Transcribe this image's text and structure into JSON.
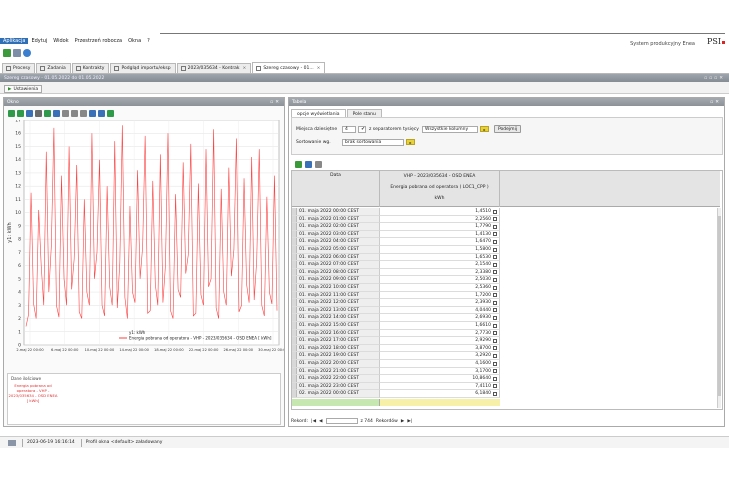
{
  "menu": [
    "Aplikacja",
    "Edytuj",
    "Widok",
    "Przestrzeń robocza",
    "Okna",
    "?"
  ],
  "app": {
    "name": "System produkcyjny Enea",
    "logo": "PSI"
  },
  "tabs": [
    {
      "label": "Procesy",
      "active": false
    },
    {
      "label": "Zadania",
      "active": false
    },
    {
      "label": "Kontrakty",
      "active": false
    },
    {
      "label": "Podgląd importu/eksp",
      "active": false
    },
    {
      "label": "2023/035634 - Kontrak",
      "active": false
    },
    {
      "label": "Szereg czasowy - 01...",
      "active": true
    }
  ],
  "window": {
    "title": "Szereg czasowy - 01.05.2022 do 01.05.2022",
    "settings_label": "Ustawienia"
  },
  "left_panel": {
    "title": "Okno",
    "legend_header": "Dane ilościowe",
    "legend_text": "Energia pobrana od operatora - VHP - 2023/035634 - OSD ENEA [ kWh]"
  },
  "right_panel": {
    "title": "Tabela",
    "subtabs": [
      "opcje wyświetlania",
      "Pole stanu"
    ],
    "decimals_label": "Miejsca dziesiętne",
    "decimals_value": "4",
    "separator_label": "z separatorem tysięcy",
    "columns_value": "Wszystkie kolumny",
    "apply_label": "Podejmij",
    "sort_label": "Sortowanie wg.",
    "sort_value": "brak sortowania",
    "col_date": "Data",
    "col_h1": "VHP - 2023/035634 - OSD ENEA",
    "col_h2": "Energia pobrana od operatora ( LOC1_CPP )",
    "col_h3": "kWh",
    "rows": [
      {
        "date": "01. maja 2022 00:00 CEST",
        "value": "1,4510"
      },
      {
        "date": "01. maja 2022 01:00 CEST",
        "value": "2,2560"
      },
      {
        "date": "01. maja 2022 02:00 CEST",
        "value": "1,7790"
      },
      {
        "date": "01. maja 2022 03:00 CEST",
        "value": "1,4130"
      },
      {
        "date": "01. maja 2022 04:00 CEST",
        "value": "1,6470"
      },
      {
        "date": "01. maja 2022 05:00 CEST",
        "value": "1,5800"
      },
      {
        "date": "01. maja 2022 06:00 CEST",
        "value": "1,6530"
      },
      {
        "date": "01. maja 2022 07:00 CEST",
        "value": "2,1540"
      },
      {
        "date": "01. maja 2022 08:00 CEST",
        "value": "2,3380"
      },
      {
        "date": "01. maja 2022 09:00 CEST",
        "value": "2,5030"
      },
      {
        "date": "01. maja 2022 10:00 CEST",
        "value": "2,5360"
      },
      {
        "date": "01. maja 2022 11:00 CEST",
        "value": "1,7200"
      },
      {
        "date": "01. maja 2022 12:00 CEST",
        "value": "2,3930"
      },
      {
        "date": "01. maja 2022 13:00 CEST",
        "value": "4,0440"
      },
      {
        "date": "01. maja 2022 14:00 CEST",
        "value": "2,6930"
      },
      {
        "date": "01. maja 2022 15:00 CEST",
        "value": "1,6610"
      },
      {
        "date": "01. maja 2022 16:00 CEST",
        "value": "2,7730"
      },
      {
        "date": "01. maja 2022 17:00 CEST",
        "value": "2,9290"
      },
      {
        "date": "01. maja 2022 18:00 CEST",
        "value": "3,8700"
      },
      {
        "date": "01. maja 2022 19:00 CEST",
        "value": "3,2920"
      },
      {
        "date": "01. maja 2022 20:00 CEST",
        "value": "4,1600"
      },
      {
        "date": "01. maja 2022 21:00 CEST",
        "value": "3,1700"
      },
      {
        "date": "01. maja 2022 22:00 CEST",
        "value": "10,8640"
      },
      {
        "date": "01. maja 2022 23:00 CEST",
        "value": "7,4110"
      },
      {
        "date": "02. maja 2022 00:00 CEST",
        "value": "6,1840"
      }
    ],
    "record_label": "Rekord:",
    "record_total": "z 744",
    "records_label": "Rekordów"
  },
  "status": {
    "timestamp": "2023-06-19 16:16:14",
    "message": "Profil okna <default> załadowany"
  },
  "colors": {
    "accent": "#2e6fb5",
    "series": "#ff4040",
    "highlight": "#e8d23a"
  },
  "chart_data": {
    "type": "line",
    "ylabel": "y1: kWh",
    "ylim": [
      0,
      17
    ],
    "yticks": [
      "0",
      "1",
      "2",
      "3",
      "4",
      "5",
      "6",
      "7",
      "8",
      "9",
      "10",
      "11",
      "12",
      "13",
      "14",
      "15",
      "16",
      "17"
    ],
    "xticks": [
      "2.maj 22 00:00",
      "6.maj 22 00:00",
      "10.maj 22 00:00",
      "14.maj 22 00:00",
      "18.maj 22 00:00",
      "22.maj 22 00:00",
      "26.maj 22 00:00",
      "30.maj 22 00:00"
    ],
    "legend_unit": "y1: kWh",
    "series": [
      {
        "name": "Energia pobrana od operatora - VHP - 2023/035634 - OSD ENEA [ kWh]",
        "values": [
          1.4,
          2.3,
          11.5,
          3.1,
          2.0,
          10.2,
          6.0,
          3.0,
          14.6,
          4.0,
          7.5,
          16.4,
          3.0,
          2.1,
          12.8,
          5.0,
          3.0,
          15.0,
          4.2,
          6.5,
          13.6,
          2.5,
          2.0,
          11.0,
          4.0,
          3.0,
          16.0,
          5.0,
          7.0,
          14.0,
          3.0,
          2.2,
          12.0,
          4.4,
          3.0,
          15.4,
          2.8,
          6.2,
          16.6,
          3.6,
          2.0,
          10.5,
          4.0,
          3.2,
          13.2,
          5.0,
          7.4,
          15.8,
          2.4,
          2.6,
          12.4,
          4.6,
          3.0,
          14.4,
          3.2,
          6.0,
          16.0,
          2.6,
          2.0,
          11.4,
          4.2,
          3.6,
          13.8,
          5.4,
          6.8,
          15.2,
          2.2,
          2.4,
          12.2,
          3.8,
          3.0,
          14.8,
          4.4,
          5.0,
          16.3,
          2.8,
          2.0,
          11.8,
          4.0,
          3.0,
          13.4,
          5.2,
          7.2,
          15.6,
          2.5,
          3.0,
          12.6,
          4.6,
          3.2,
          14.2,
          3.4,
          6.4,
          14.8,
          3.0,
          2.2,
          11.2,
          4.0,
          3.1,
          12.8,
          2.6
        ]
      }
    ]
  }
}
